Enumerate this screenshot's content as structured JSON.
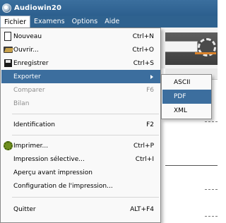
{
  "window": {
    "title": "Audiowin20"
  },
  "menubar": {
    "items": [
      {
        "label": "Fichier",
        "active": true
      },
      {
        "label": "Examens"
      },
      {
        "label": "Options"
      },
      {
        "label": "Aide"
      }
    ]
  },
  "file_menu": {
    "items": [
      {
        "label": "Nouveau",
        "shortcut": "Ctrl+N",
        "icon": "new-document-icon"
      },
      {
        "label": "Ouvrir...",
        "shortcut": "Ctrl+O",
        "icon": "open-folder-icon"
      },
      {
        "label": "Enregistrer",
        "shortcut": "Ctrl+S",
        "icon": "floppy-disk-icon"
      },
      {
        "label": "Exporter",
        "highlighted": true,
        "submenu": true
      },
      {
        "label": "Comparer",
        "shortcut": "F6",
        "disabled": true
      },
      {
        "label": "Bilan",
        "disabled": true
      },
      {
        "label": "Identification",
        "shortcut": "F2"
      },
      {
        "label": "Imprimer...",
        "shortcut": "Ctrl+P",
        "icon": "printer-gear-icon"
      },
      {
        "label": "Impression sélective...",
        "shortcut": "Ctrl+I"
      },
      {
        "label": "Aperçu avant impression"
      },
      {
        "label": "Configuration de l'impression..."
      },
      {
        "label": "Quitter",
        "shortcut": "ALT+F4"
      }
    ]
  },
  "export_submenu": {
    "items": [
      {
        "label": "ASCII"
      },
      {
        "label": "PDF",
        "highlighted": true
      },
      {
        "label": "XML"
      }
    ]
  },
  "colors": {
    "titlebar": "#2c5f8e",
    "highlight": "#3c6e9e",
    "disabled_text": "#8d8d8d"
  }
}
